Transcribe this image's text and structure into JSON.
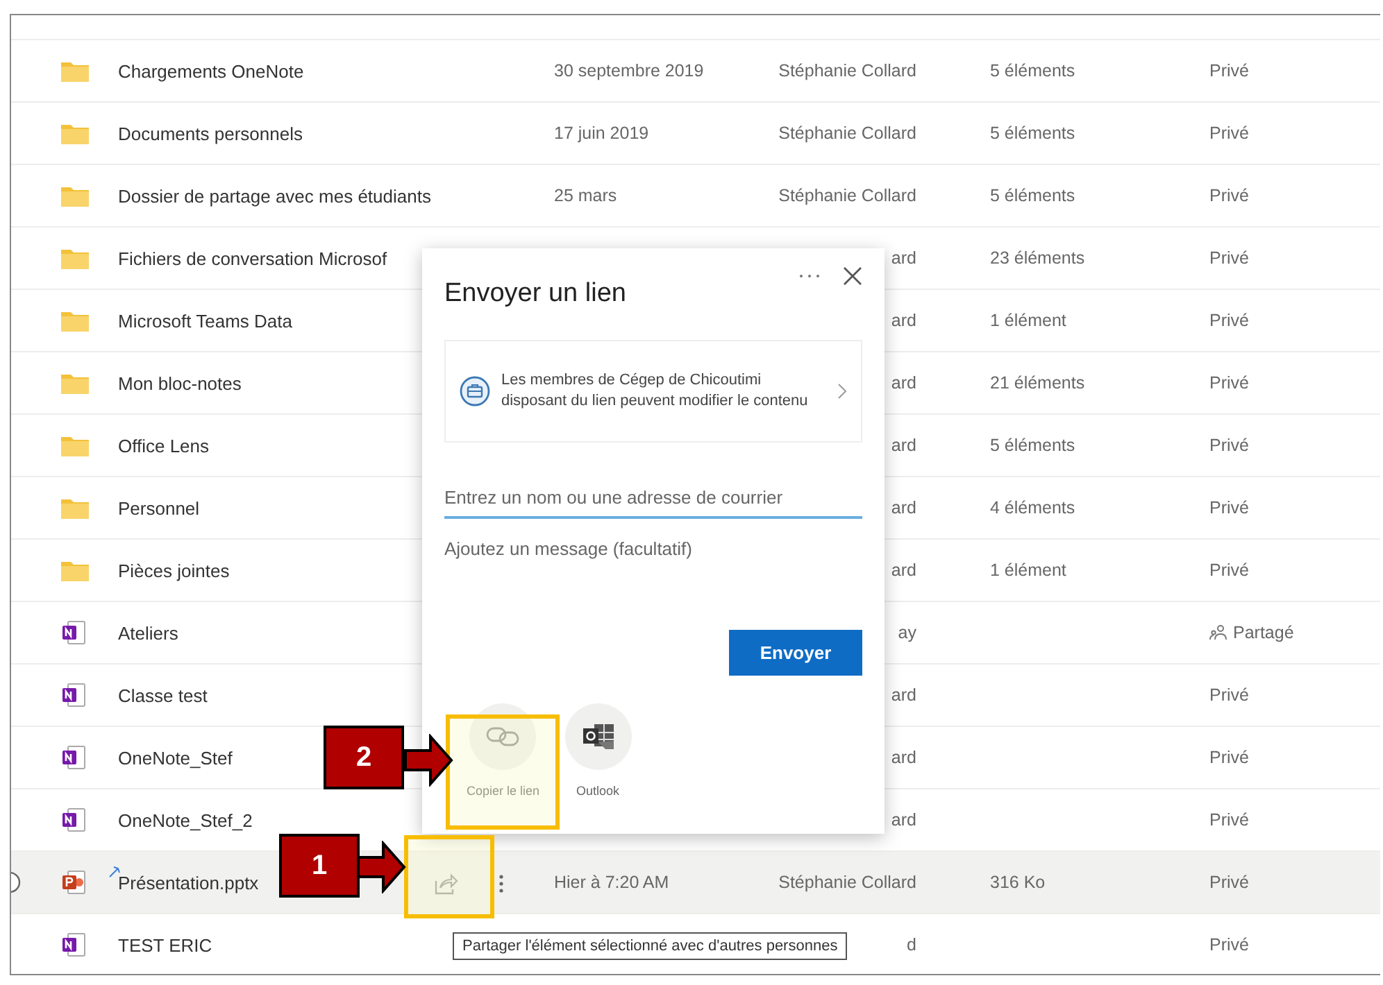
{
  "rows": [
    {
      "kind": "folder",
      "name": "Chargements OneNote",
      "modified": "30 septembre 2019",
      "modified_by": "Stéphanie Collard",
      "size": "5 éléments",
      "sharing": "Privé",
      "shared": false,
      "selected": false,
      "new": false
    },
    {
      "kind": "folder",
      "name": "Documents personnels",
      "modified": "17 juin 2019",
      "modified_by": "Stéphanie Collard",
      "size": "5 éléments",
      "sharing": "Privé",
      "shared": false,
      "selected": false,
      "new": false
    },
    {
      "kind": "folder",
      "name": "Dossier de partage avec mes étudiants",
      "modified": "25 mars",
      "modified_by": "Stéphanie Collard",
      "size": "5 éléments",
      "sharing": "Privé",
      "shared": false,
      "selected": false,
      "new": false
    },
    {
      "kind": "folder",
      "name": "Fichiers de conversation Microsof",
      "modified_by": "ard",
      "size": "23 éléments",
      "sharing": "Privé",
      "shared": false,
      "selected": false,
      "new": false
    },
    {
      "kind": "folder",
      "name": "Microsoft Teams Data",
      "modified_by": "ard",
      "size": "1 élément",
      "sharing": "Privé",
      "shared": false,
      "selected": false,
      "new": false
    },
    {
      "kind": "folder",
      "name": "Mon bloc-notes",
      "modified_by": "ard",
      "size": "21 éléments",
      "sharing": "Privé",
      "shared": false,
      "selected": false,
      "new": false
    },
    {
      "kind": "folder",
      "name": "Office Lens",
      "modified_by": "ard",
      "size": "5 éléments",
      "sharing": "Privé",
      "shared": false,
      "selected": false,
      "new": false
    },
    {
      "kind": "folder",
      "name": "Personnel",
      "modified_by": "ard",
      "size": "4 éléments",
      "sharing": "Privé",
      "shared": false,
      "selected": false,
      "new": false
    },
    {
      "kind": "folder",
      "name": "Pièces jointes",
      "modified_by": "ard",
      "size": "1 élément",
      "sharing": "Privé",
      "shared": false,
      "selected": false,
      "new": false
    },
    {
      "kind": "onenote",
      "name": "Ateliers",
      "modified_by": "ay",
      "sharing": "Partagé",
      "shared": true,
      "selected": false,
      "new": false
    },
    {
      "kind": "onenote",
      "name": "Classe test",
      "modified_by": "ard",
      "sharing": "Privé",
      "shared": false,
      "selected": false,
      "new": false
    },
    {
      "kind": "onenote",
      "name": "OneNote_Stef",
      "modified_by": "ard",
      "sharing": "Privé",
      "shared": false,
      "selected": false,
      "new": false
    },
    {
      "kind": "onenote",
      "name": "OneNote_Stef_2",
      "modified_by": "ard",
      "sharing": "Privé",
      "shared": false,
      "selected": false,
      "new": false
    },
    {
      "kind": "pptx",
      "name": "Présentation.pptx",
      "modified": "Hier à 7:20 AM",
      "modified_by": "Stéphanie Collard",
      "size": "316 Ko",
      "sharing": "Privé",
      "shared": false,
      "selected": true,
      "new": true
    },
    {
      "kind": "onenote",
      "name": "TEST ERIC",
      "modified_by": "d",
      "sharing": "Privé",
      "shared": false,
      "selected": false,
      "new": false
    }
  ],
  "dialog": {
    "title": "Envoyer un lien",
    "link_settings": "Les membres de Cégep de Chicoutimi disposant du lien peuvent modifier le contenu",
    "recipient_placeholder": "Entrez un nom ou une adresse de courrier",
    "message_placeholder": "Ajoutez un message (facultatif)",
    "send": "Envoyer",
    "options": [
      {
        "kind": "copy_link",
        "label": "Copier le lien"
      },
      {
        "kind": "outlook",
        "label": "Outlook"
      }
    ]
  },
  "tooltip": "Partager l'élément sélectionné avec d'autres personnes",
  "callouts": [
    {
      "number": "2",
      "kind": "copy_link"
    },
    {
      "number": "1",
      "kind": "share_button"
    }
  ]
}
